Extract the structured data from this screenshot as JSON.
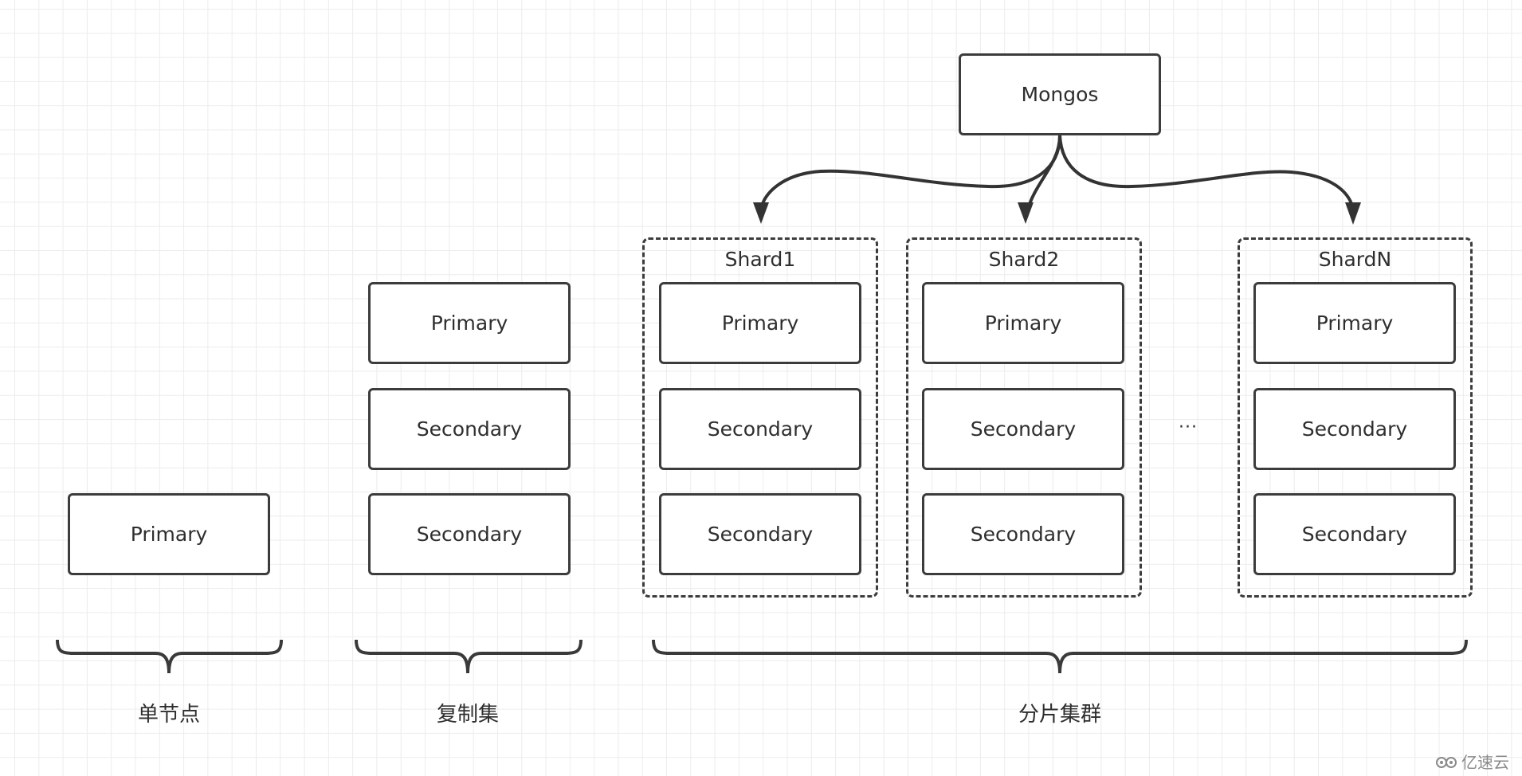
{
  "diagram": {
    "mongos": {
      "label": "Mongos"
    },
    "single_node": {
      "nodes": [
        "Primary"
      ],
      "caption": "单节点"
    },
    "replica_set": {
      "nodes": [
        "Primary",
        "Secondary",
        "Secondary"
      ],
      "caption": "复制集"
    },
    "sharded_cluster": {
      "shards": [
        {
          "title": "Shard1",
          "nodes": [
            "Primary",
            "Secondary",
            "Secondary"
          ]
        },
        {
          "title": "Shard2",
          "nodes": [
            "Primary",
            "Secondary",
            "Secondary"
          ]
        },
        {
          "title": "ShardN",
          "nodes": [
            "Primary",
            "Secondary",
            "Secondary"
          ]
        }
      ],
      "ellipsis": "...",
      "caption": "分片集群"
    },
    "edges": [
      {
        "from": "Mongos",
        "to": "Shard1"
      },
      {
        "from": "Mongos",
        "to": "Shard2"
      },
      {
        "from": "Mongos",
        "to": "ShardN"
      }
    ]
  },
  "watermark": {
    "icon": "cloud-logo-icon",
    "text": "亿速云"
  },
  "colors": {
    "stroke": "#3c3c3c",
    "text": "#2e2e2e",
    "grid": "#ececec"
  }
}
